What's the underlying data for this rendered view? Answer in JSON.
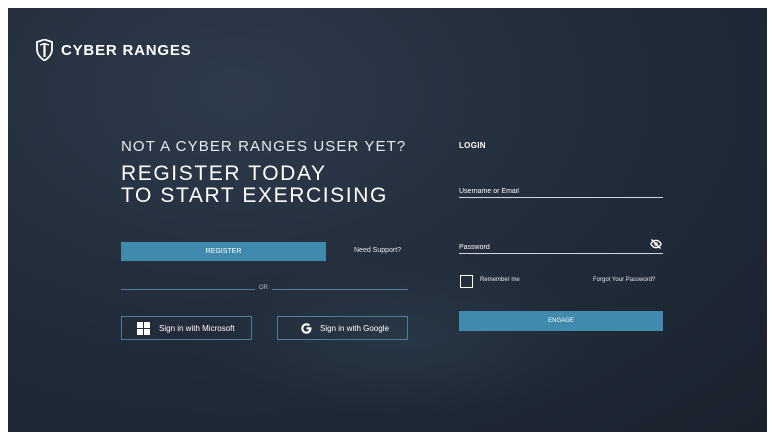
{
  "brand": {
    "name": "CYBER RANGES",
    "logo_icon": "shield-logo-icon"
  },
  "intro": {
    "question": "NOT A CYBER RANGES USER YET?",
    "headline_line1": "REGISTER TODAY",
    "headline_line2": "TO START EXERCISING"
  },
  "register": {
    "label": "REGISTER",
    "support_link": "Need Support?"
  },
  "divider": {
    "text": "OR"
  },
  "social": {
    "microsoft": {
      "label": "Sign in with Microsoft",
      "icon": "microsoft-icon"
    },
    "google": {
      "label": "Sign in with Google",
      "icon": "google-icon"
    }
  },
  "login": {
    "heading": "LOGIN",
    "username_placeholder": "Username or Email",
    "username_value": "",
    "password_placeholder": "Password",
    "password_value": "",
    "password_toggle_icon": "eye-slash-icon",
    "remember_label": "Remember me",
    "remember_checked": false,
    "forgot_link": "Forgot Your Password?",
    "submit_label": "ENGAGE"
  },
  "colors": {
    "background": "#232d3b",
    "accent": "#3f8aad",
    "divider": "#4f7f98",
    "text": "#ffffff"
  }
}
